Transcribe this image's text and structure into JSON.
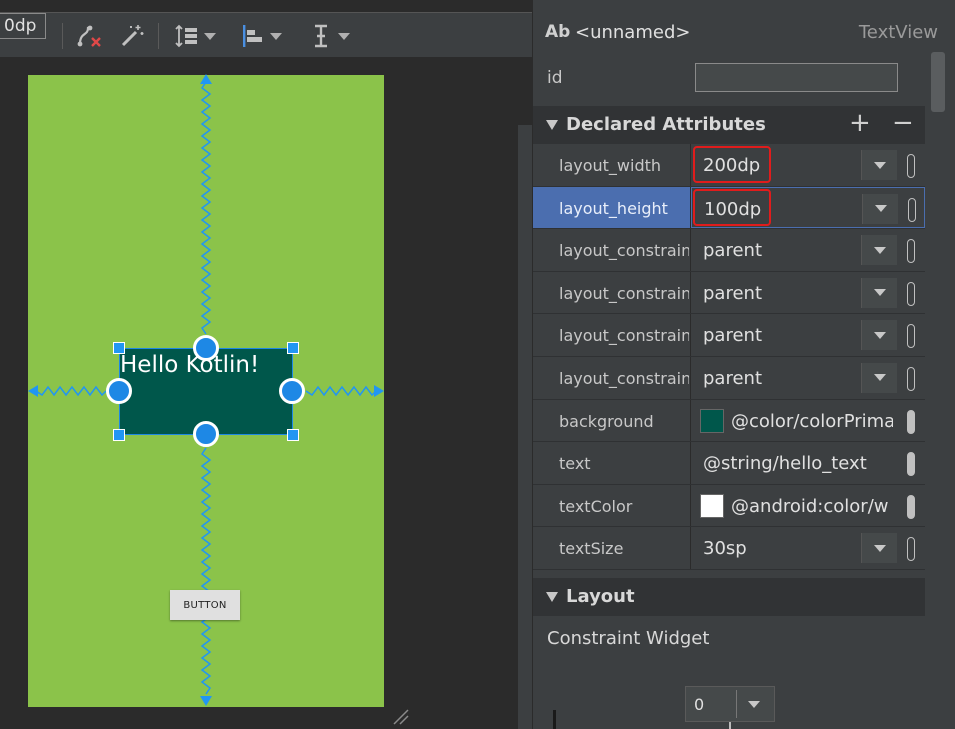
{
  "toolbar": {
    "default_margin": "0dp",
    "icons": [
      "clear-constraints-icon",
      "infer-constraints-icon",
      "pack-icon",
      "align-icon",
      "guidelines-icon"
    ]
  },
  "canvas": {
    "device_background": "#8bc34a",
    "textview": {
      "text": "Hello Kotlin!",
      "background": "#00574b",
      "text_color": "#ffffff"
    },
    "button": {
      "label": "BUTTON"
    },
    "constraint_color": "#2196f3"
  },
  "attributes": {
    "header": {
      "ab_icon": "Ab",
      "name": "<unnamed>",
      "widget_type": "TextView"
    },
    "id": {
      "label": "id",
      "value": ""
    },
    "declared": {
      "title": "Declared Attributes",
      "add_label": "+",
      "remove_label": "−",
      "rows": [
        {
          "label": "layout_width",
          "value": "200dp",
          "dropdown": true,
          "highlight": true
        },
        {
          "label": "layout_height",
          "value": "100dp",
          "dropdown": true,
          "highlight": true,
          "selected": true
        },
        {
          "label": "layout_constraint",
          "value": "parent",
          "dropdown": true
        },
        {
          "label": "layout_constraint",
          "value": "parent",
          "dropdown": true
        },
        {
          "label": "layout_constraint",
          "value": "parent",
          "dropdown": true
        },
        {
          "label": "layout_constraint",
          "value": "parent",
          "dropdown": true
        },
        {
          "label": "background",
          "value": "@color/colorPrima",
          "swatch": "#00574b"
        },
        {
          "label": "text",
          "value": "@string/hello_text"
        },
        {
          "label": "textColor",
          "value": "@android:color/w",
          "swatch": "#ffffff"
        },
        {
          "label": "textSize",
          "value": "30sp",
          "dropdown": true
        }
      ]
    },
    "layout_section": {
      "title": "Layout",
      "constraint_widget_label": "Constraint Widget",
      "margin_value": "0"
    }
  },
  "colors": {
    "selection": "#4b6eaf",
    "highlight_box": "#e01c1c",
    "panel": "#3c3f41"
  }
}
